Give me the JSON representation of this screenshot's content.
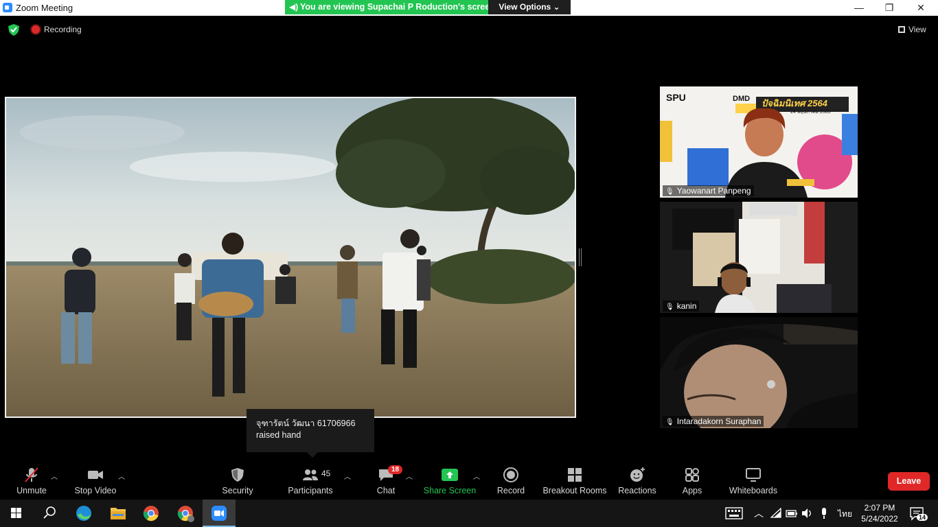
{
  "window": {
    "title": "Zoom Meeting",
    "minimize": "—",
    "restore": "❐",
    "close": "✕"
  },
  "share_banner": {
    "text": "You are viewing Supachai P Roduction's screen",
    "view_options": "View Options ⌄"
  },
  "status": {
    "recording_label": "Recording",
    "view_label": "View"
  },
  "participants": [
    {
      "name": "Yaowanart Panpeng"
    },
    {
      "name": "kanin"
    },
    {
      "name": "Intaradakorn Suraphan"
    }
  ],
  "tile1_overlay": {
    "logo": "SPU",
    "event": "ปัจฉิมนิเทศ 2564",
    "date": "24 พฤษภาคม 2565",
    "dm": "DMD"
  },
  "tooltip": {
    "line1": "จุฑารัตน์ วัฒนา 61706966",
    "line2": "raised hand"
  },
  "toolbar": {
    "unmute": "Unmute",
    "stop_video": "Stop Video",
    "security": "Security",
    "participants": "Participants",
    "participants_count": "45",
    "chat": "Chat",
    "chat_badge": "18",
    "share_screen": "Share Screen",
    "record": "Record",
    "breakout_rooms": "Breakout Rooms",
    "reactions": "Reactions",
    "apps": "Apps",
    "whiteboards": "Whiteboards",
    "leave": "Leave"
  },
  "taskbar": {
    "lang": "ไทย",
    "time": "2:07 PM",
    "date": "5/24/2022",
    "notif_count": "14"
  },
  "colors": {
    "accent_green": "#23c552",
    "leave_red": "#e02828",
    "badge_red": "#e02828"
  }
}
